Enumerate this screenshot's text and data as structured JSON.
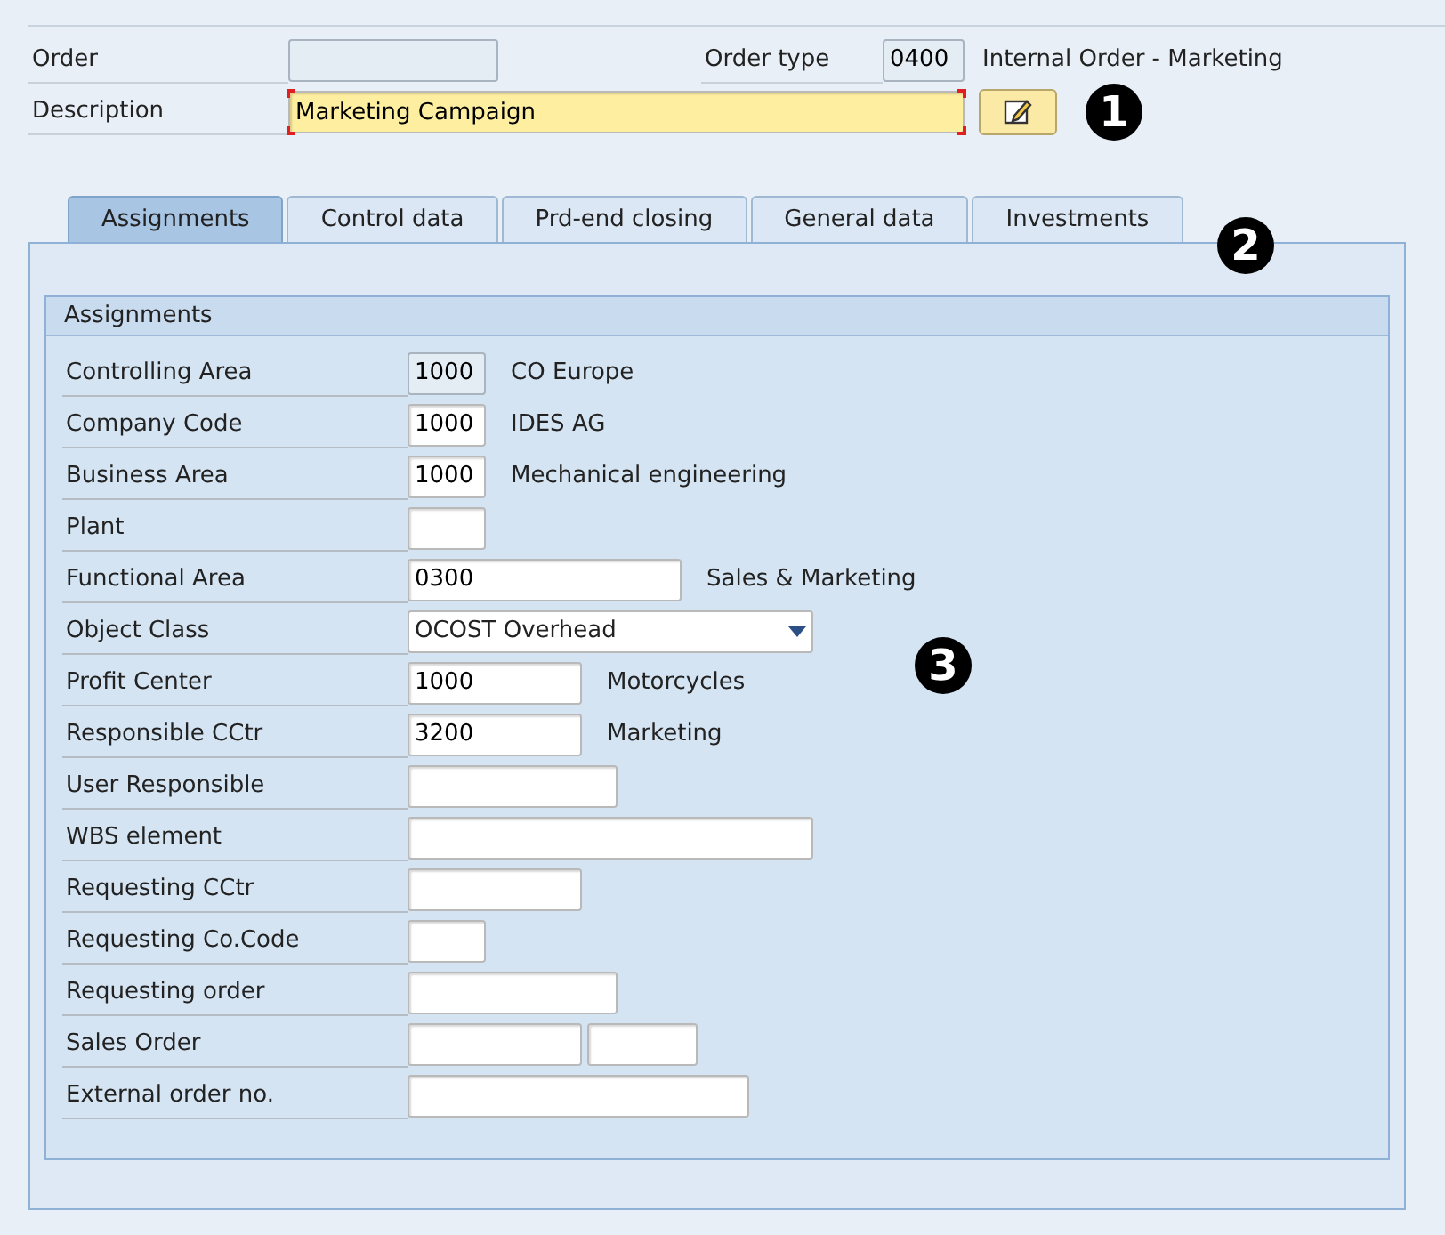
{
  "header": {
    "order": {
      "label": "Order",
      "disabled": true
    },
    "order_type": {
      "label": "Order type",
      "value": "0400",
      "text": "Internal Order - Marketing",
      "disabled": true
    },
    "description": {
      "label": "Description",
      "value": "Marketing Campaign",
      "required": true
    }
  },
  "callouts": [
    "1",
    "2",
    "3"
  ],
  "tabs": [
    {
      "label": "Assignments",
      "selected": true
    },
    {
      "label": "Control data",
      "selected": false
    },
    {
      "label": "Prd-end closing",
      "selected": false
    },
    {
      "label": "General data",
      "selected": false
    },
    {
      "label": "Investments",
      "selected": false
    }
  ],
  "group": {
    "title": "Assignments",
    "rows": [
      {
        "kind": "input",
        "label": "Controlling Area",
        "value": "1000",
        "text": "CO Europe",
        "disabled": true
      },
      {
        "kind": "input",
        "label": "Company Code",
        "value": "1000",
        "text": "IDES AG",
        "disabled": false
      },
      {
        "kind": "input",
        "label": "Business Area",
        "value": "1000",
        "text": "Mechanical engineering",
        "disabled": false
      },
      {
        "kind": "input",
        "label": "Plant",
        "disabled": false
      },
      {
        "kind": "input",
        "label": "Functional Area",
        "value": "0300",
        "text": "Sales & Marketing",
        "disabled": false
      },
      {
        "kind": "select",
        "label": "Object Class",
        "value": "OCOST Overhead",
        "disabled": false
      },
      {
        "kind": "input",
        "label": "Profit Center",
        "value": "1000",
        "text": "Motorcycles",
        "disabled": false
      },
      {
        "kind": "input",
        "label": "Responsible CCtr",
        "value": "3200",
        "text": "Marketing",
        "disabled": false
      },
      {
        "kind": "input",
        "label": "User Responsible",
        "disabled": false
      },
      {
        "kind": "input",
        "label": "WBS element",
        "disabled": false
      },
      {
        "kind": "input",
        "label": "Requesting CCtr",
        "disabled": false
      },
      {
        "kind": "input",
        "label": "Requesting Co.Code",
        "disabled": false
      },
      {
        "kind": "input",
        "label": "Requesting order",
        "disabled": false
      },
      {
        "kind": "pair",
        "label": "Sales Order",
        "disabled": false
      },
      {
        "kind": "input",
        "label": "External order no.",
        "disabled": false
      }
    ]
  }
}
